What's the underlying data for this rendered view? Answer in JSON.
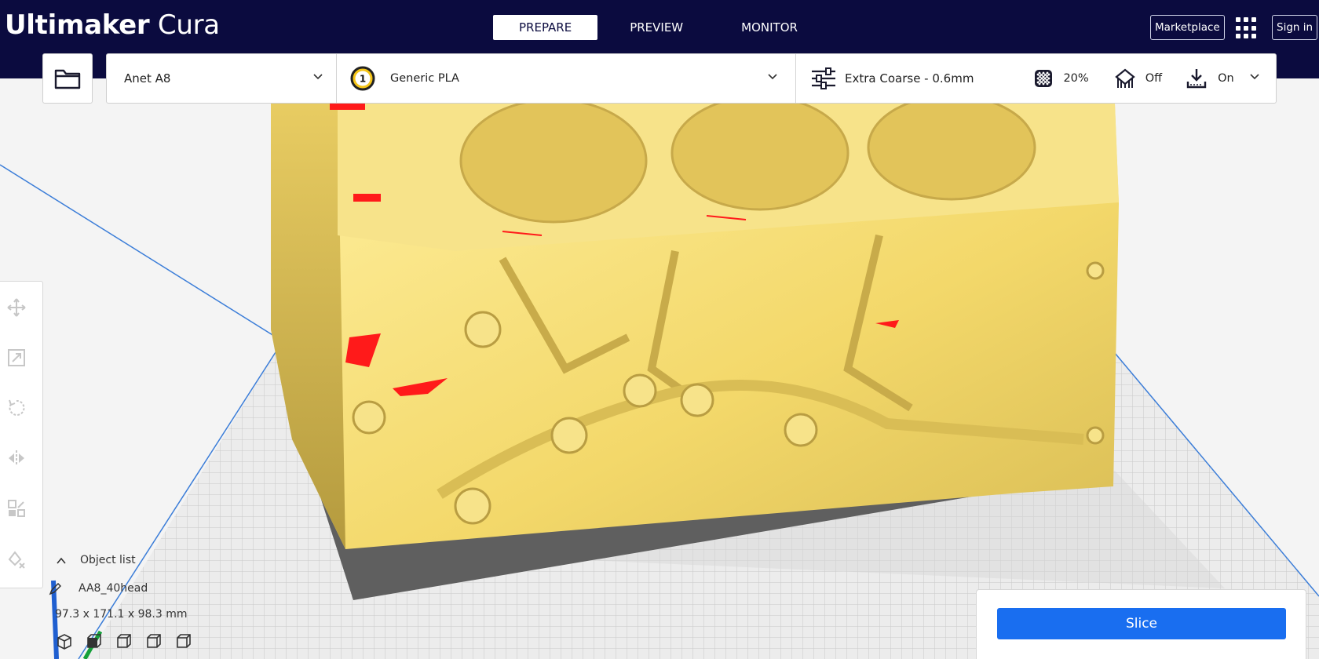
{
  "app": {
    "brand_bold": "Ultimaker",
    "brand_light": "Cura"
  },
  "stages": [
    "PREPARE",
    "PREVIEW",
    "MONITOR"
  ],
  "active_stage": "PREPARE",
  "header_right": {
    "marketplace": "Marketplace",
    "sign_in": "Sign in",
    "apps_icon": "grid-icon"
  },
  "printer": {
    "name": "Anet A8"
  },
  "material": {
    "extruder_number": "1",
    "name": "Generic PLA"
  },
  "print_settings": {
    "profile": "Extra Coarse - 0.6mm",
    "infill": "20%",
    "support": "Off",
    "adhesion": "On"
  },
  "tools": [
    "move-icon",
    "scale-icon",
    "rotate-icon",
    "mirror-icon",
    "per-model-settings-icon",
    "support-blocker-icon"
  ],
  "object_list": {
    "header": "Object list",
    "object_name": "AA8_40head",
    "dimensions": "97.3 x 171.1 x 98.3 mm"
  },
  "slice": {
    "label": "Slice"
  },
  "colors": {
    "header_bg": "#0b0b3f",
    "accent": "#196ef0",
    "model": "#f7e07a",
    "overhang": "#ff1a1a"
  }
}
